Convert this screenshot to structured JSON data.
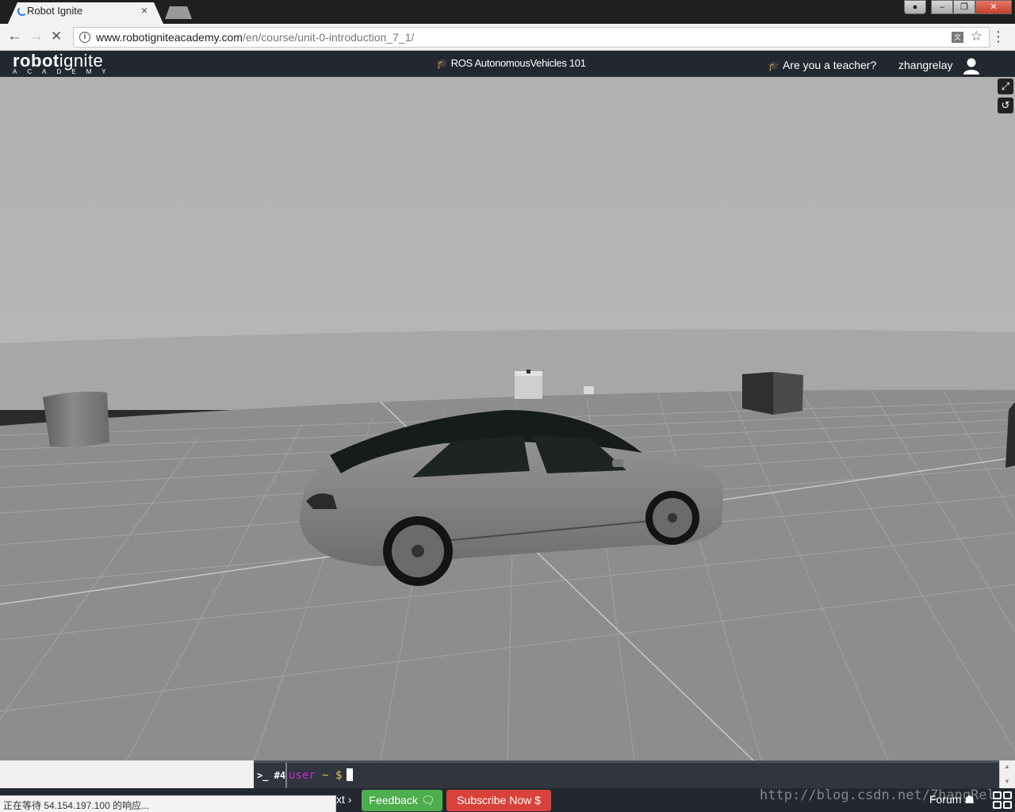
{
  "browser": {
    "tab_title": "Robot Ignite",
    "tab_close": "×",
    "url_host": "www.robotigniteacademy.com",
    "url_path": "/en/course/unit-0-introduction_7_1/",
    "info_icon": "i",
    "window_buttons": {
      "user": "●",
      "minimize": "–",
      "maximize": "❐",
      "close": "✕"
    }
  },
  "app": {
    "logo_main_bold": "robot",
    "logo_main_light": "ignite",
    "logo_sub": "ACADEMY",
    "course_title": "ROS AutonomousVehicles 101",
    "teacher_link": "Are you a teacher?",
    "username": "zhangrelay"
  },
  "viewport": {
    "fullscreen_icon": "⤢",
    "reset_icon": "↺",
    "sky_color": "#b3b3b3",
    "ground_color": "#8c8c8c"
  },
  "terminal": {
    "tab_label": ">_ #4",
    "prompt_user": "user",
    "prompt_tail": " ~ $"
  },
  "bottom": {
    "status_text": "正在等待 54.154.197.100 的响应...",
    "next_label": "xt ›",
    "feedback_label": "Feedback 🗨",
    "subscribe_label": "Subscribe Now $",
    "forum_label": "Forum ☗",
    "watermark": "http://blog.csdn.net/ZhangRel"
  }
}
